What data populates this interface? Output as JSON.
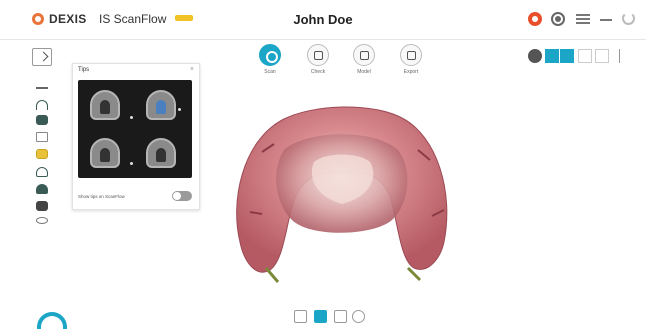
{
  "app": {
    "brand": "DEXIS",
    "product": "IS ScanFlow",
    "patient_name": "John Doe",
    "accent_color": "#1ba6c7",
    "brand_color": "#e8743b"
  },
  "toolbar": {
    "items": [
      {
        "label": "Scan",
        "icon": "scan-icon",
        "active": true
      },
      {
        "label": "Check",
        "icon": "check-icon",
        "active": false
      },
      {
        "label": "Model",
        "icon": "model-icon",
        "active": false
      },
      {
        "label": "Export",
        "icon": "export-icon",
        "active": false
      }
    ]
  },
  "tips": {
    "title": "Tips",
    "close_glyph": "×",
    "toggle_label": "Show tips on ScanFlow",
    "toggle_on": false
  },
  "left_tools": [
    "cut-icon",
    "upper-arch-icon",
    "lower-arch-icon",
    "note-icon",
    "bite-icon",
    "impression-icon",
    "model-scan-icon",
    "paint-icon",
    "eye-icon"
  ],
  "view_controls": [
    "jaw-icon",
    "color-on-icon",
    "texture-on-icon",
    "grid-icon",
    "lock-icon"
  ],
  "bottom_tools": [
    "bookmark-icon",
    "active-view-icon",
    "home-icon",
    "settings-icon"
  ]
}
